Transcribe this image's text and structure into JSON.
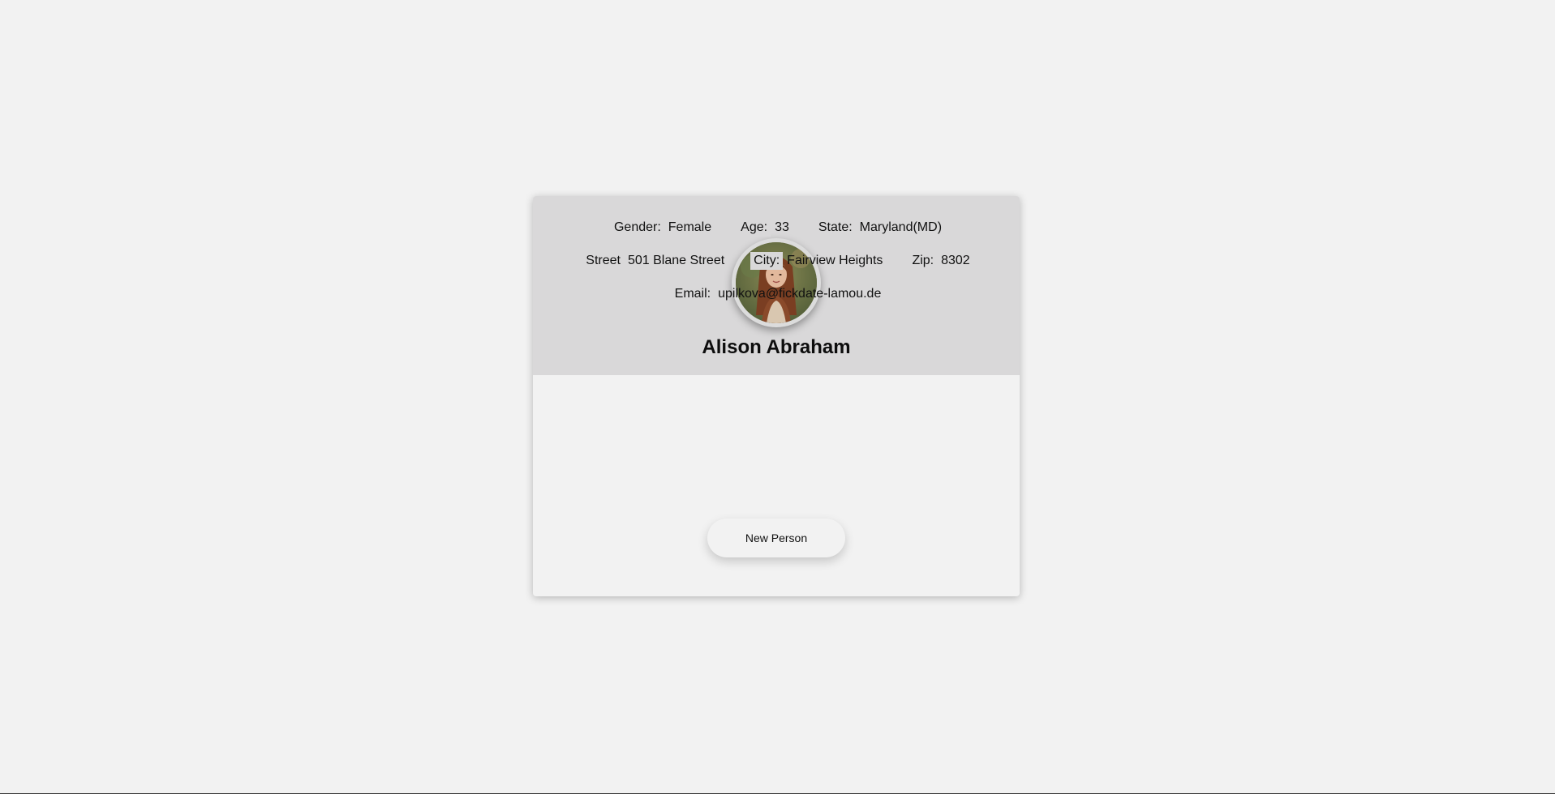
{
  "profile": {
    "name": "Alison Abraham",
    "avatar_icon": "woman-portrait-photo"
  },
  "fields": {
    "gender": {
      "label": "Gender:",
      "value": "Female"
    },
    "age": {
      "label": "Age:",
      "value": "33"
    },
    "state": {
      "label": "State:",
      "value": "Maryland(MD)"
    },
    "street": {
      "label": "Street",
      "value": "501 Blane Street"
    },
    "city": {
      "label": "City:",
      "value": "Fairview Heights"
    },
    "zip": {
      "label": "Zip:",
      "value": "8302"
    },
    "email": {
      "label": "Email:",
      "value": "upilkova@fickdate-lamou.de"
    }
  },
  "actions": {
    "new_person_label": "New Person"
  },
  "colors": {
    "page_background": "#f2f2f2",
    "header_background": "#d9d8d9",
    "label_background": "#d9d8d9"
  }
}
